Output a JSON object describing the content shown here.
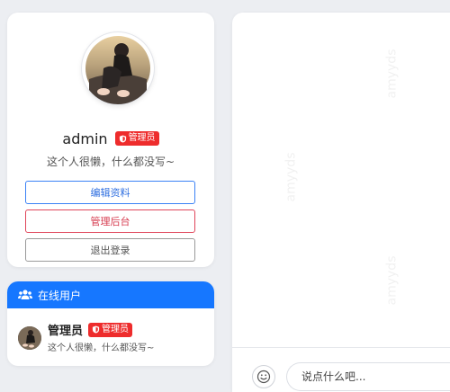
{
  "profile": {
    "username": "admin",
    "role_badge": "管理员",
    "bio": "这个人很懒，什么都没写~",
    "avatar_icon": "user-avatar-photo",
    "buttons": {
      "edit": "编辑资料",
      "admin": "管理后台",
      "logout": "退出登录"
    }
  },
  "online_users": {
    "title": "在线用户",
    "title_icon": "users-icon",
    "users": [
      {
        "name": "管理员",
        "role_badge": "管理员",
        "bio": "这个人很懒，什么都没写~"
      }
    ]
  },
  "chat": {
    "watermark": "amyyds",
    "input_placeholder": "说点什么吧...",
    "emoji_icon": "smile-icon"
  },
  "colors": {
    "primary": "#1677ff",
    "danger": "#ee2c2c",
    "edit_border": "#3b82f6",
    "admin_border": "#e0455a"
  }
}
